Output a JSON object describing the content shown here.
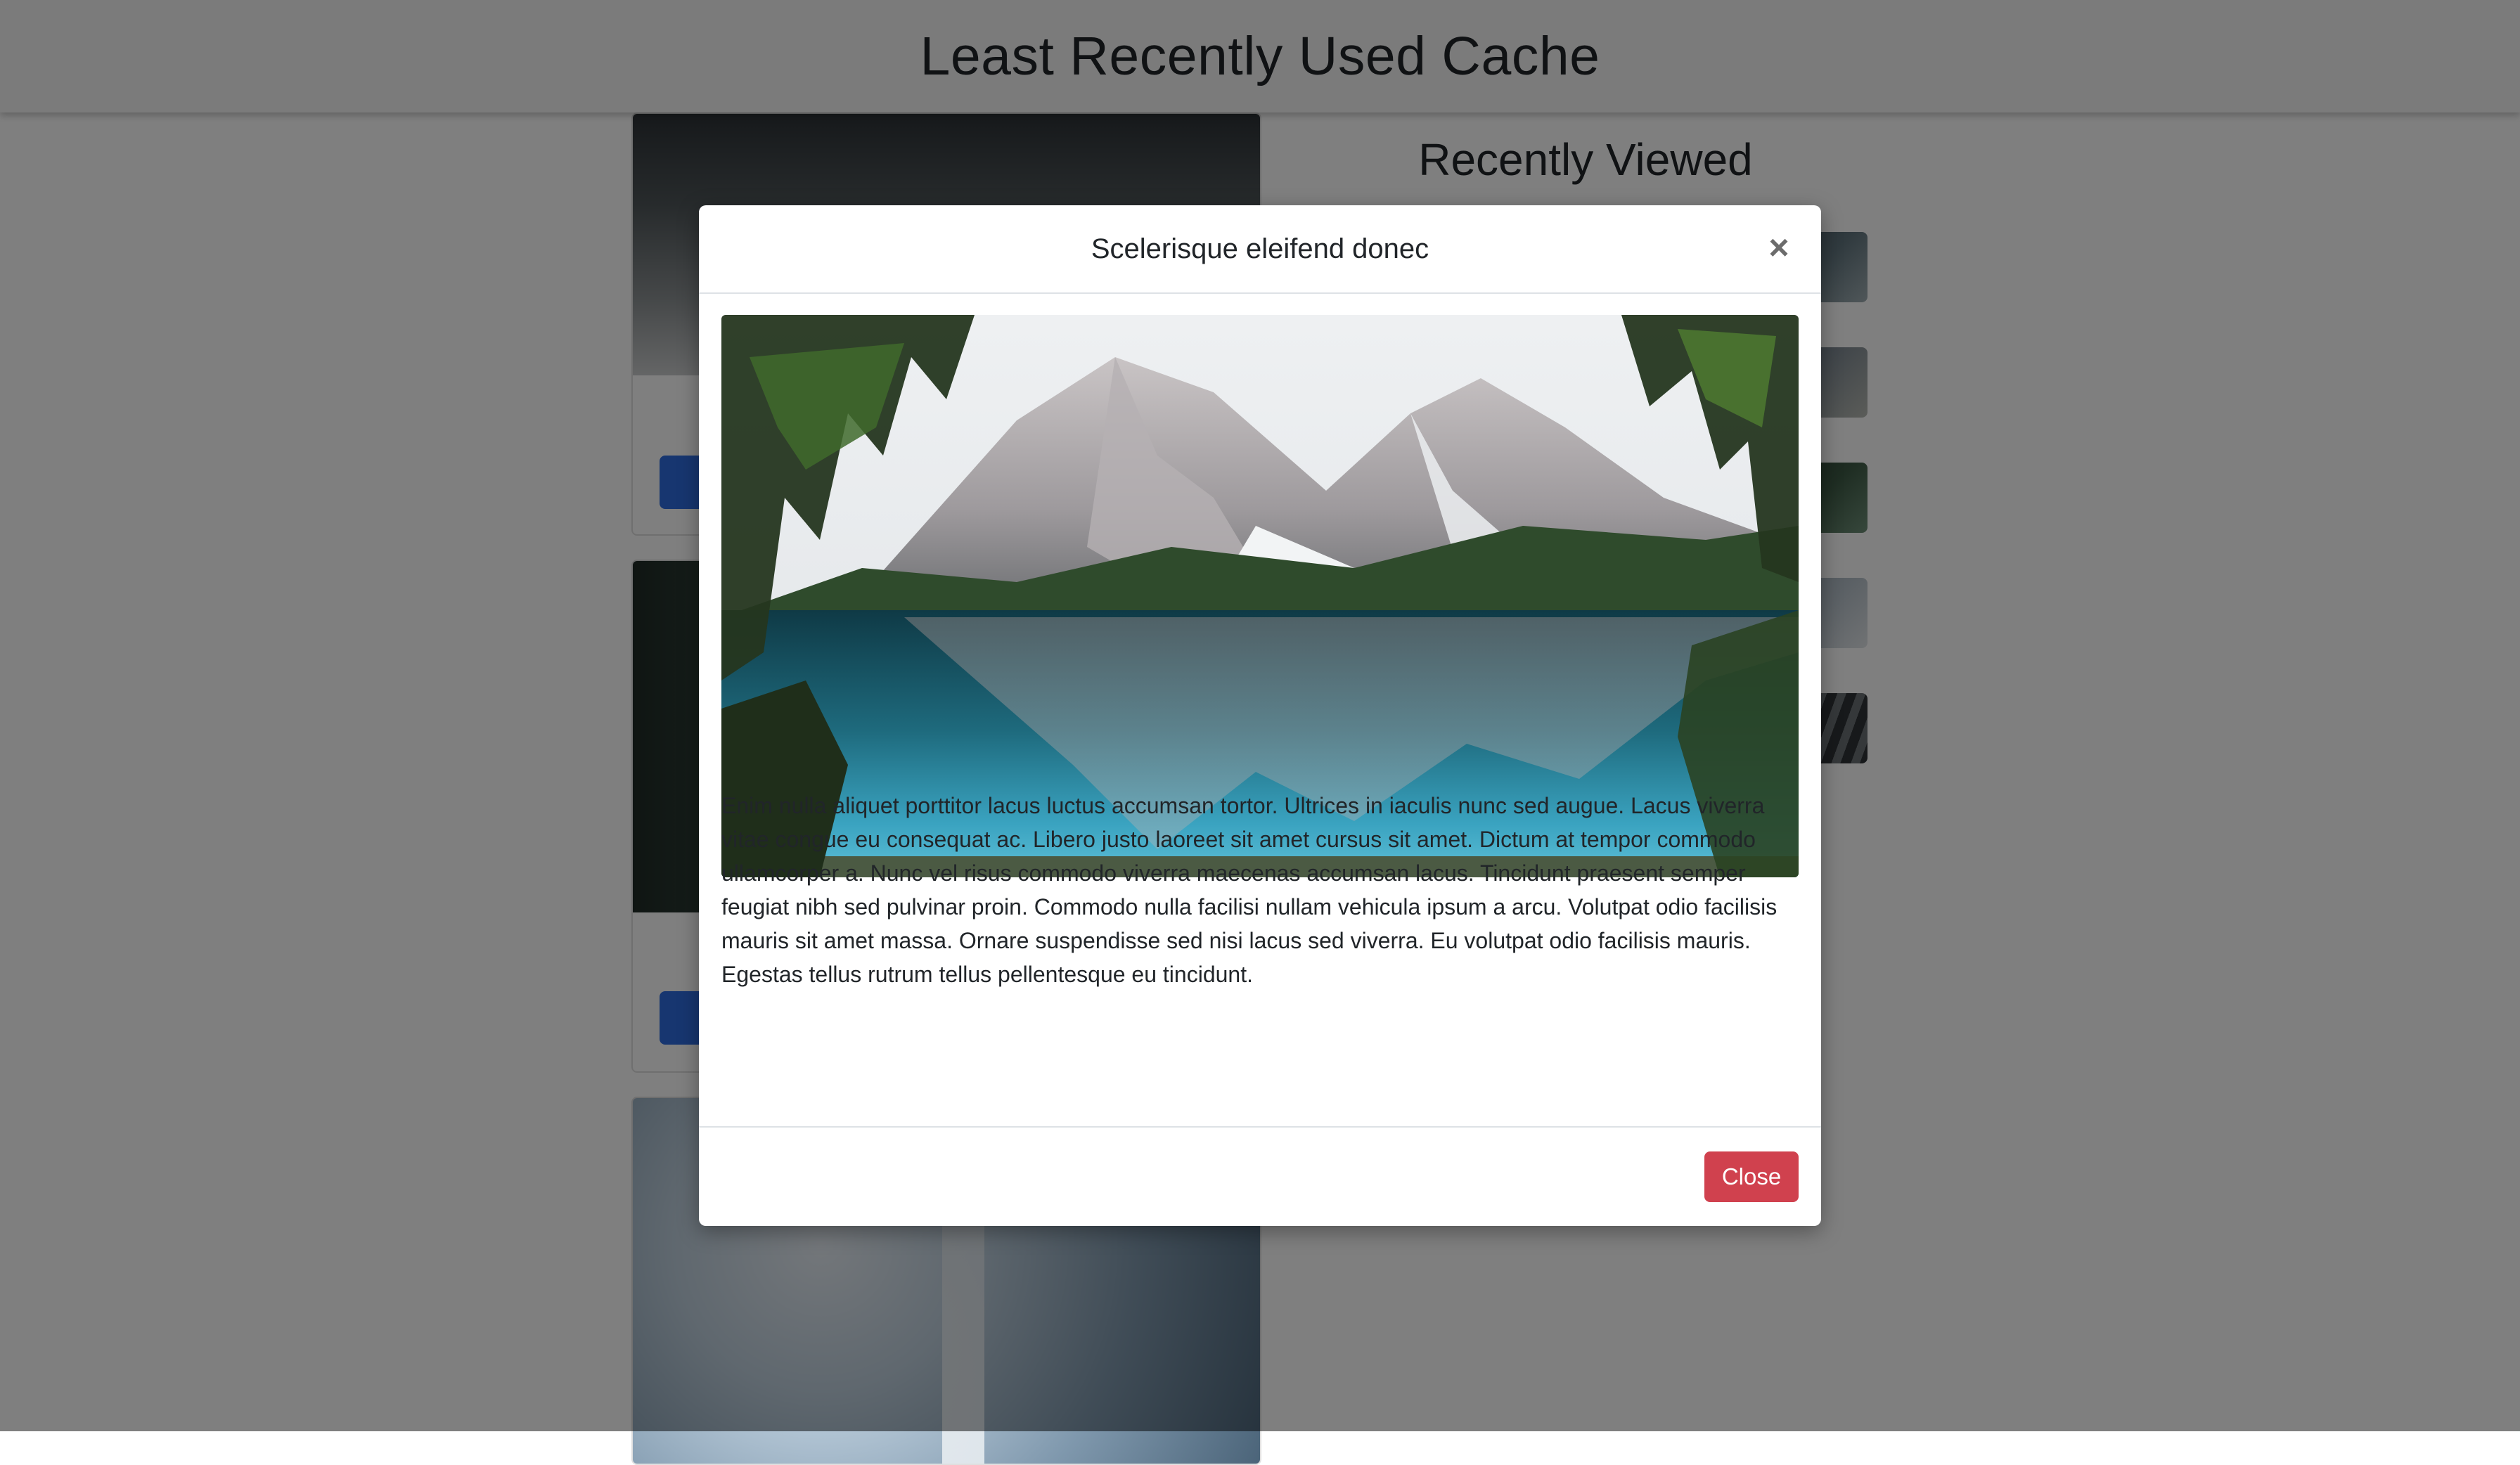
{
  "app": {
    "title": "Least Recently Used Cache"
  },
  "recent": {
    "title": "Recently Viewed"
  },
  "modal": {
    "title": "Scelerisque eleifend donec",
    "close_icon_label": "×",
    "body": "Enim nulla aliquet porttitor lacus luctus accumsan tortor. Ultrices in iaculis nunc sed augue. Lacus viverra vitae congue eu consequat ac. Libero justo laoreet sit amet cursus sit amet. Dictum at tempor commodo ullamcorper a. Nunc vel risus commodo viverra maecenas accumsan lacus. Tincidunt praesent semper feugiat nibh sed pulvinar proin. Commodo nulla facilisi nullam vehicula ipsum a arcu. Volutpat odio facilisis mauris sit amet massa. Ornare suspendisse sed nisi lacus sed viverra. Eu volutpat odio facilisis mauris. Egestas tellus rutrum tellus pellentesque eu tincidunt.",
    "close_button_label": "Close"
  },
  "colors": {
    "primary_button": "#2f6de0",
    "danger_button": "#d0414e",
    "backdrop": "rgba(0,0,0,0.5)"
  },
  "icons": {
    "close": "close-icon"
  }
}
